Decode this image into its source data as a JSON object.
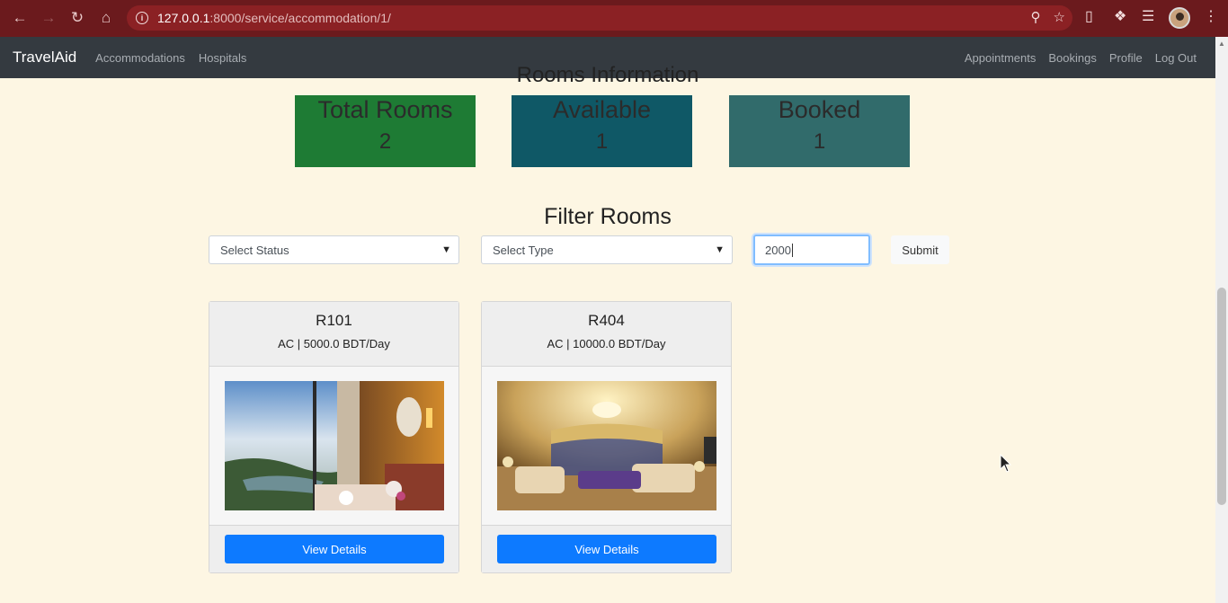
{
  "browser": {
    "url_host": "127.0.0.1",
    "url_path": ":8000/service/accommodation/1/"
  },
  "navbar": {
    "brand": "TravelAid",
    "left_links": [
      "Accommodations",
      "Hospitals"
    ],
    "right_links": [
      "Appointments",
      "Bookings",
      "Profile",
      "Log Out"
    ]
  },
  "rooms_info": {
    "title": "Rooms Information",
    "stats": [
      {
        "label": "Total Rooms",
        "value": "2",
        "color": "#1e7b34"
      },
      {
        "label": "Available",
        "value": "1",
        "color": "#0f5866"
      },
      {
        "label": "Booked",
        "value": "1",
        "color": "#316b6b"
      }
    ]
  },
  "filter": {
    "title": "Filter Rooms",
    "status_select": "Select Status",
    "type_select": "Select Type",
    "price_value": "2000",
    "submit_label": "Submit"
  },
  "rooms": [
    {
      "name": "R101",
      "details": "AC | 5000.0 BDT/Day",
      "button": "View Details"
    },
    {
      "name": "R404",
      "details": "AC | 10000.0 BDT/Day",
      "button": "View Details"
    }
  ],
  "colors": {
    "page_bg": "#fdf6e3",
    "navbar_bg": "#343a40",
    "primary_button": "#0d7aff",
    "browser_frame": "#6b1a1d"
  }
}
